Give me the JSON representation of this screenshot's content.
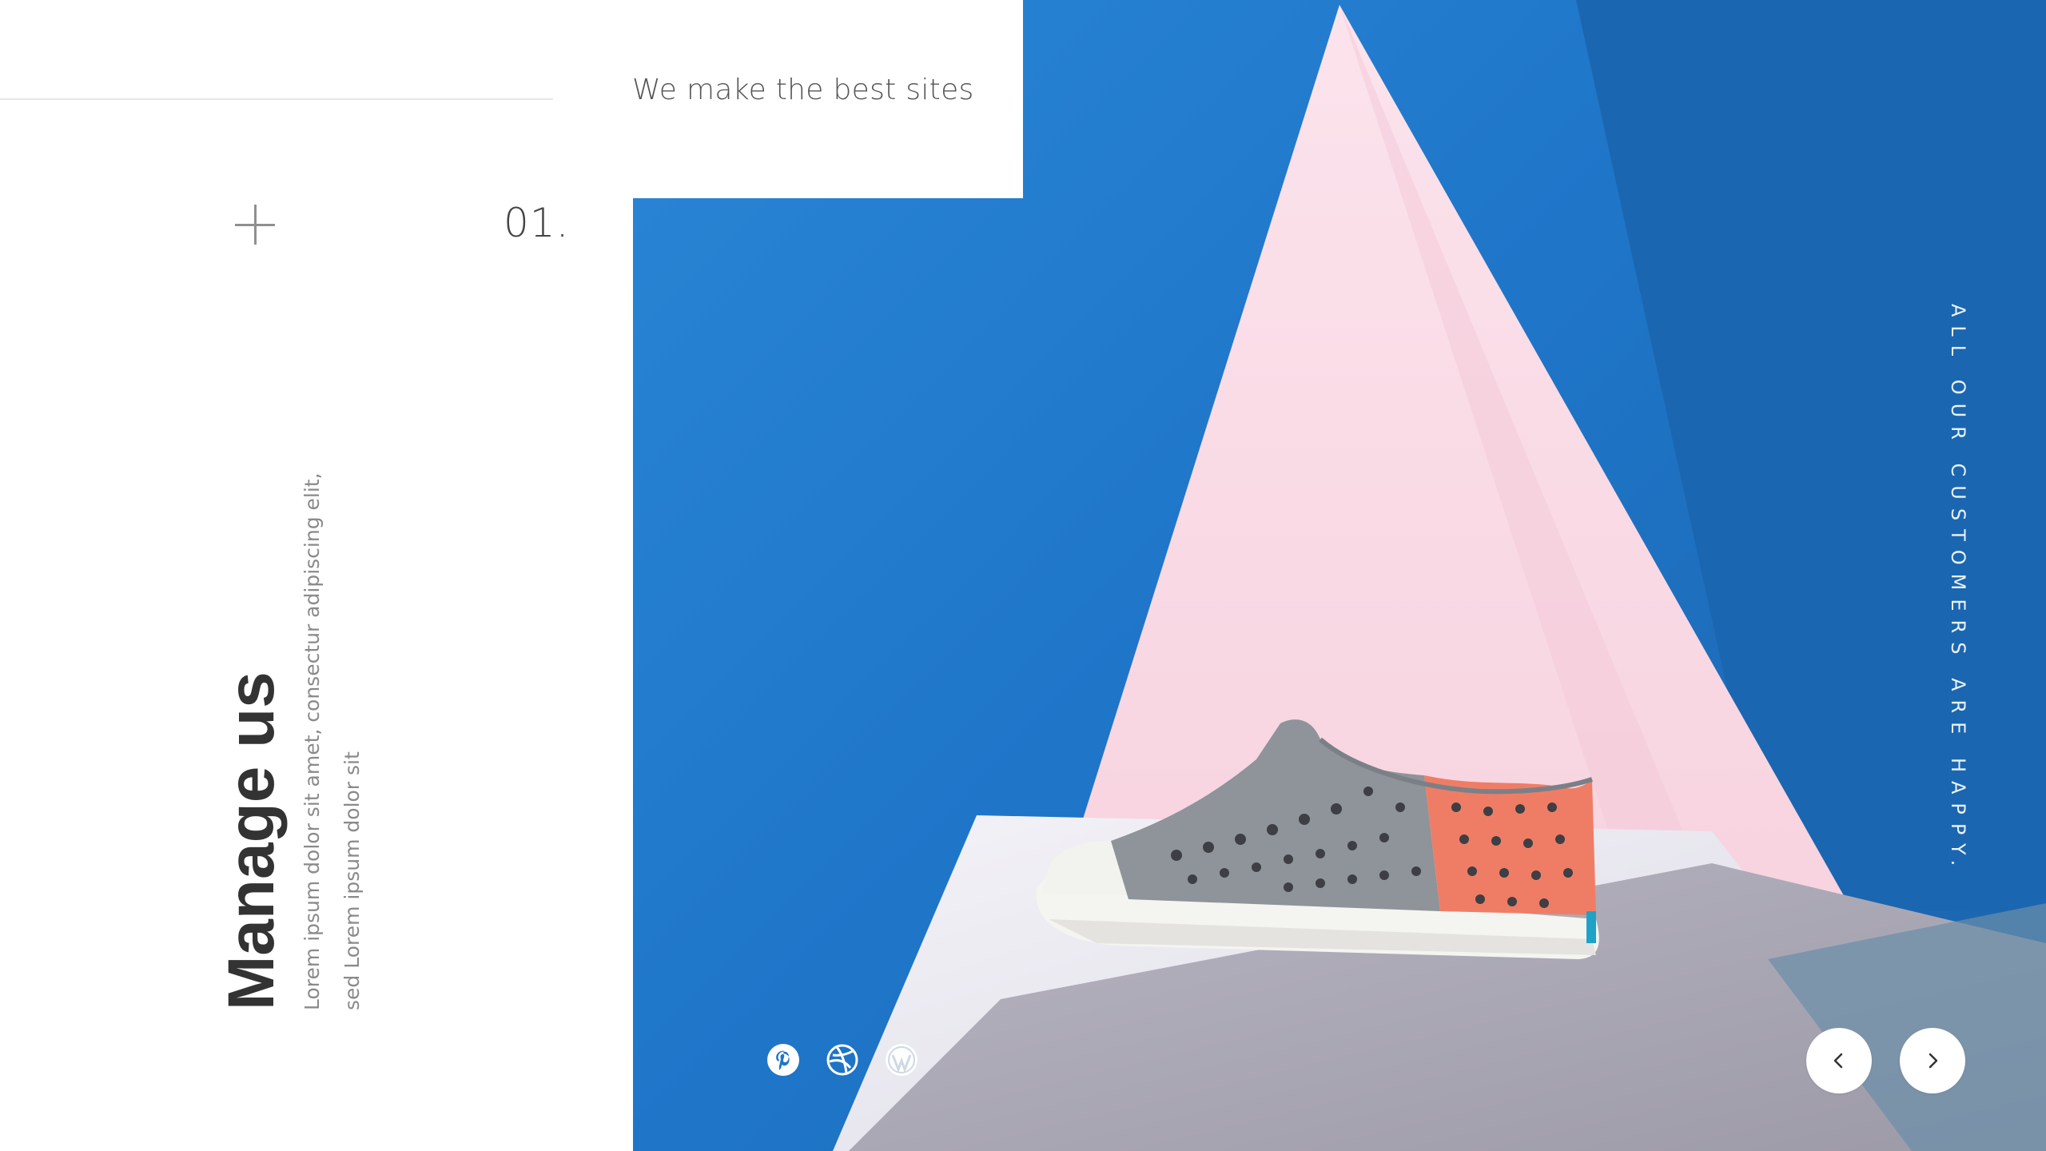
{
  "header": {
    "tagline": "We make the best sites"
  },
  "slide": {
    "number": "01.",
    "title": "Manage us",
    "description": "Lorem ipsum dolor sit amet, consectur adipiscing elit, sed Lorem ipsum dolor sit"
  },
  "hero": {
    "side_caption": "ALL OUR CUSTOMERS ARE HAPPY."
  },
  "social": [
    {
      "icon": "pinterest-icon"
    },
    {
      "icon": "dribbble-icon"
    },
    {
      "icon": "wordpress-icon"
    }
  ],
  "navigation": {
    "prev_icon": "chevron-left-icon",
    "next_icon": "chevron-right-icon"
  },
  "colors": {
    "accent_blue": "#1f76c9",
    "pink": "#f7d6e1",
    "shoe_coral": "#ef7d66",
    "shoe_grey": "#8e9499",
    "text_dark": "#333333"
  }
}
